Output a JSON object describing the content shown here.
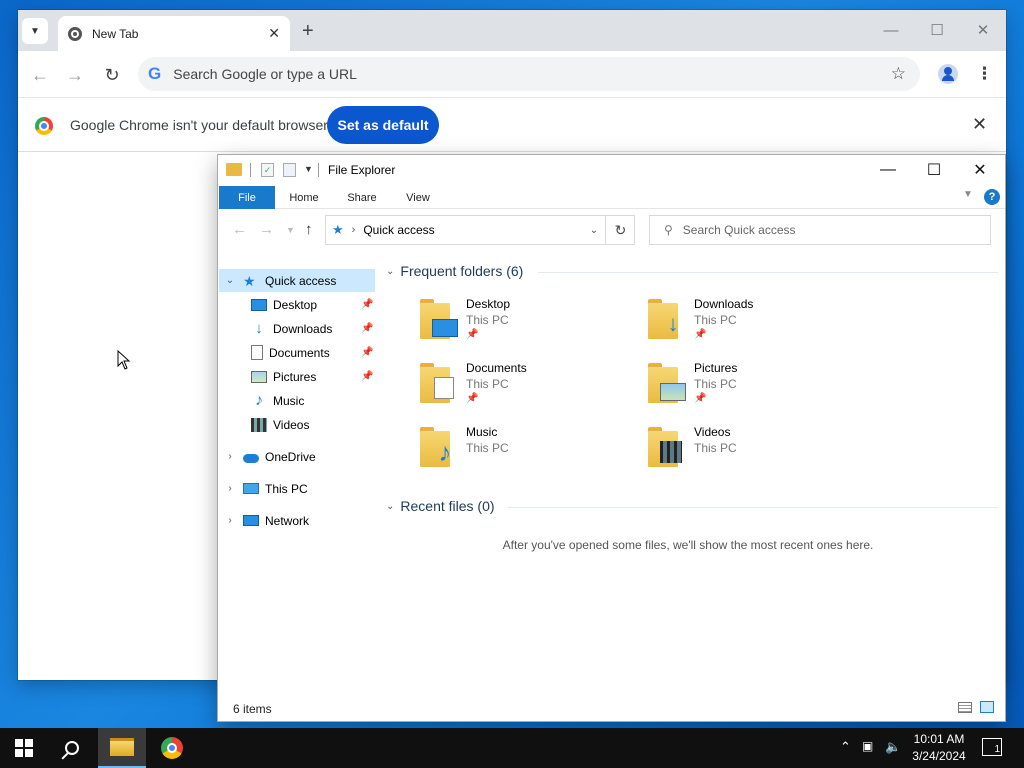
{
  "chrome": {
    "tab_title": "New Tab",
    "new_tab_glyph": "+",
    "omnibox_placeholder": "Search Google or type a URL",
    "omnibox_g": "G",
    "infobar_message": "Google Chrome isn't your default browser",
    "set_default_label": "Set as default",
    "icons": {
      "back": "arrow-left",
      "forward": "arrow-right",
      "reload": "reload",
      "star": "star",
      "menu": "kebab",
      "profile": "person"
    }
  },
  "explorer": {
    "window_title": "File Explorer",
    "ribbon_tabs": [
      "File",
      "Home",
      "Share",
      "View"
    ],
    "address_path": "Quick access",
    "search_placeholder": "Search Quick access",
    "nav": {
      "quick_access": "Quick access",
      "pinned": [
        "Desktop",
        "Downloads",
        "Documents",
        "Pictures"
      ],
      "unpinned": [
        "Music",
        "Videos"
      ],
      "onedrive": "OneDrive",
      "this_pc": "This PC",
      "network": "Network"
    },
    "frequent_header": "Frequent folders (6)",
    "frequent_folders": [
      {
        "name": "Desktop",
        "location": "This PC",
        "pinned": true
      },
      {
        "name": "Downloads",
        "location": "This PC",
        "pinned": true
      },
      {
        "name": "Documents",
        "location": "This PC",
        "pinned": true
      },
      {
        "name": "Pictures",
        "location": "This PC",
        "pinned": true
      },
      {
        "name": "Music",
        "location": "This PC",
        "pinned": false
      },
      {
        "name": "Videos",
        "location": "This PC",
        "pinned": false
      }
    ],
    "recent_header": "Recent files (0)",
    "recent_empty_text": "After you've opened some files, we'll show the most recent ones here.",
    "status_count": "6 items",
    "accent": "#1979ca",
    "selected_bg": "#cce8ff"
  },
  "taskbar": {
    "time": "10:01 AM",
    "date": "3/24/2024",
    "notification_count": "1",
    "active_app": "File Explorer"
  }
}
